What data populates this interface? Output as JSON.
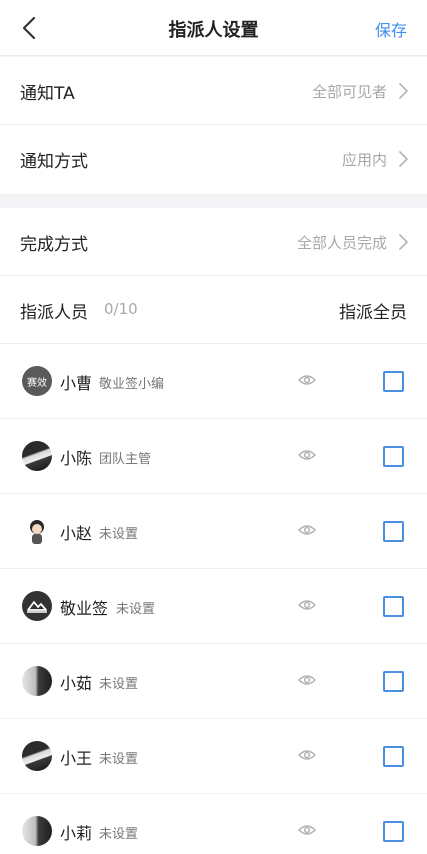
{
  "nav": {
    "title": "指派人设置",
    "save_label": "保存",
    "back_icon": "chevron-left-icon"
  },
  "settings": {
    "notify_ta": {
      "label": "通知TA",
      "value": "全部可见者"
    },
    "notify_method": {
      "label": "通知方式",
      "value": "应用内"
    },
    "complete_method": {
      "label": "完成方式",
      "value": "全部人员完成"
    }
  },
  "assignees": {
    "label": "指派人员",
    "count": "0/10",
    "assign_all_label": "指派全员",
    "members": [
      {
        "name": "小曹",
        "role": "敬业签小编",
        "avatar_text": "赛效",
        "checked": false
      },
      {
        "name": "小陈",
        "role": "团队主管",
        "checked": false
      },
      {
        "name": "小赵",
        "role": "未设置",
        "checked": false
      },
      {
        "name": "敬业签",
        "role": "未设置",
        "checked": false
      },
      {
        "name": "小茹",
        "role": "未设置",
        "checked": false
      },
      {
        "name": "小王",
        "role": "未设置",
        "checked": false
      },
      {
        "name": "小莉",
        "role": "未设置",
        "checked": false
      }
    ]
  },
  "colors": {
    "accent": "#3f8ff0",
    "checkbox": "#4a90e2",
    "muted": "#a8a8a8"
  }
}
